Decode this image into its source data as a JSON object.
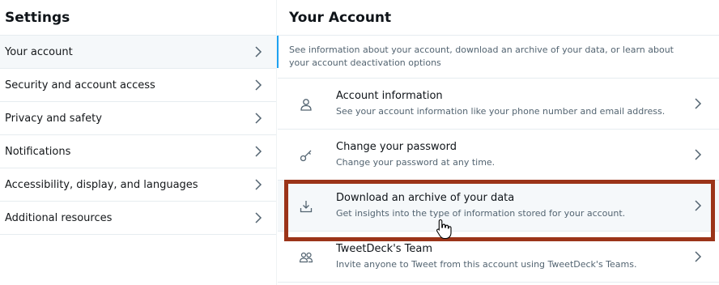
{
  "settings": {
    "title": "Settings",
    "items": [
      {
        "label": "Your account"
      },
      {
        "label": "Security and account access"
      },
      {
        "label": "Privacy and safety"
      },
      {
        "label": "Notifications"
      },
      {
        "label": "Accessibility, display, and languages"
      },
      {
        "label": "Additional resources"
      }
    ]
  },
  "account": {
    "title": "Your Account",
    "description": "See information about your account, download an archive of your data, or learn about your account deactivation options",
    "items": [
      {
        "title": "Account information",
        "subtitle": "See your account information like your phone number and email address.",
        "icon": "person-icon"
      },
      {
        "title": "Change your password",
        "subtitle": "Change your password at any time.",
        "icon": "key-icon"
      },
      {
        "title": "Download an archive of your data",
        "subtitle": "Get insights into the type of information stored for your account.",
        "icon": "download-icon"
      },
      {
        "title": "TweetDeck's Team",
        "subtitle": "Invite anyone to Tweet from this account using TweetDeck's Teams.",
        "icon": "team-icon"
      }
    ]
  },
  "colors": {
    "accent": "#1da1f2",
    "highlight_border": "#9b3419"
  }
}
